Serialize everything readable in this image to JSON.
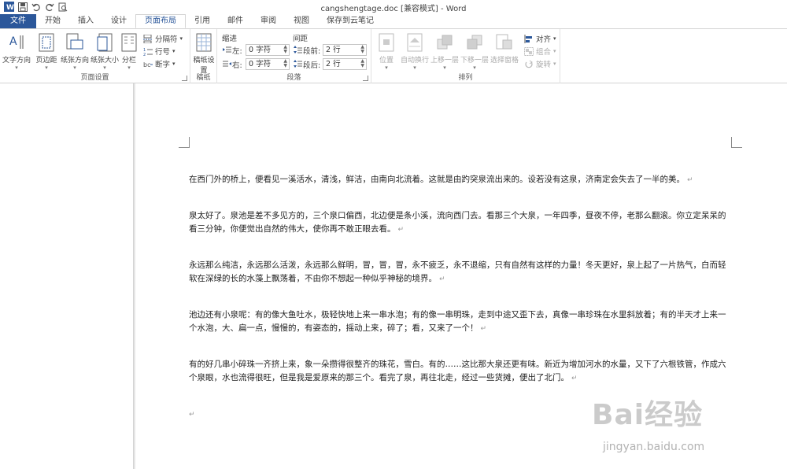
{
  "window": {
    "title": "cangshengtage.doc [兼容模式] - Word"
  },
  "quick_access": [
    "word-app-icon",
    "save-icon",
    "undo-icon",
    "redo-icon",
    "print-preview-icon"
  ],
  "tabs": [
    {
      "label": "文件",
      "kind": "file"
    },
    {
      "label": "开始"
    },
    {
      "label": "插入"
    },
    {
      "label": "设计"
    },
    {
      "label": "页面布局",
      "kind": "active"
    },
    {
      "label": "引用"
    },
    {
      "label": "邮件"
    },
    {
      "label": "审阅"
    },
    {
      "label": "视图"
    },
    {
      "label": "保存到云笔记"
    }
  ],
  "ribbon": {
    "page_setup": {
      "label": "页面设置",
      "text_direction": "文字方向",
      "margins": "页边距",
      "orientation": "纸张方向",
      "size": "纸张大小",
      "columns": "分栏",
      "breaks": "分隔符",
      "line_numbers": "行号",
      "hyphenation": "断字"
    },
    "manuscript": {
      "label": "稿纸",
      "button": "稿纸设置"
    },
    "paragraph": {
      "label": "段落",
      "indent_title": "缩进",
      "spacing_title": "间距",
      "left_label": "左:",
      "right_label": "右:",
      "before_label": "段前:",
      "after_label": "段后:",
      "left_value": "0 字符",
      "right_value": "0 字符",
      "before_value": "2 行",
      "after_value": "2 行"
    },
    "arrange": {
      "label": "排列",
      "position": "位置",
      "wrap_text": "自动换行",
      "bring_forward": "上移一层",
      "send_backward": "下移一层",
      "selection_pane": "选择窗格",
      "align": "对齐",
      "group": "组合",
      "rotate": "旋转"
    }
  },
  "document": {
    "paragraphs": [
      "在西门外的桥上，便看见一溪活水，清浅，鲜洁，由南向北流着。这就是由趵突泉流出来的。设若没有这泉，济南定会失去了一半的美。",
      "泉太好了。泉池是差不多见方的，三个泉口偏西，北边便是条小溪，流向西门去。看那三个大泉，一年四季，昼夜不停，老那么翻滚。你立定呆呆的看三分钟，你便觉出自然的伟大，使你再不敢正眼去看。",
      "永远那么纯洁，永远那么活泼，永远那么鲜明，冒，冒，冒，永不疲乏，永不退缩，只有自然有这样的力量！冬天更好，泉上起了一片热气，白而轻软在深绿的长的水藻上飘荡着，不由你不想起一种似乎神秘的境界。",
      "池边还有小泉呢：有的像大鱼吐水，极轻快地上来一串水泡；有的像一串明珠，走到中途又歪下去，真像一串珍珠在水里斜放着；有的半天才上来一个水泡，大、扁一点，慢慢的，有姿态的，摇动上来，碎了；看，又来了一个！",
      "有的好几串小碎珠一齐挤上来，象一朵攒得很整齐的珠花，雪白。有的……这比那大泉还更有味。新近为增加河水的水量，又下了六根铁管，作成六个泉眼，水也流得很旺，但是我是爱原来的那三个。看完了泉，再往北走，经过一些货摊，便出了北门。"
    ],
    "paragraph_mark": "↵"
  },
  "watermark": {
    "brand": "Bai经验",
    "url": "jingyan.baidu.com"
  }
}
